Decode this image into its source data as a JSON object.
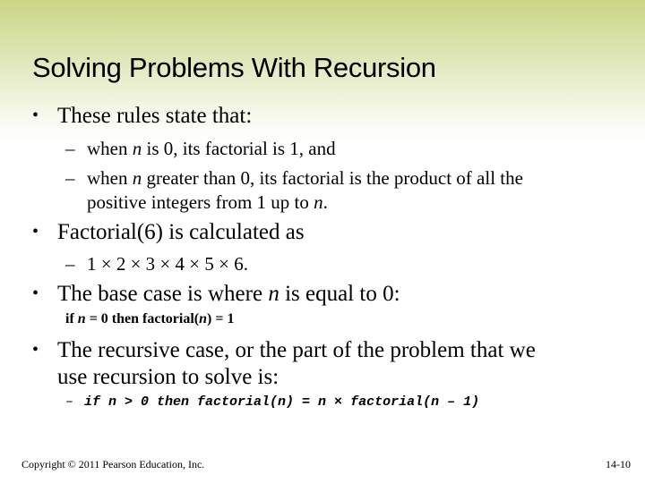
{
  "slide": {
    "title": "Solving Problems With Recursion",
    "bullets": [
      {
        "label": "These rules state that:"
      },
      {
        "label": "Factorial(6) is calculated as"
      },
      {
        "label": "The base case is where n is equal to 0:"
      },
      {
        "label_line1": "The recursive case, or the part of the problem that we",
        "label_line2": "use recursion to solve is:"
      }
    ],
    "sub_bullets": {
      "rule1": {
        "pre": "when ",
        "var": "n",
        "post": " is 0, its factorial is 1, and"
      },
      "rule2": {
        "pre": "when ",
        "var": "n",
        "post": " greater than 0, its factorial is the product of all the",
        "line2_pre": "positive integers from 1 up to ",
        "line2_var": "n",
        "line2_post": "."
      },
      "product": "1 × 2 × 3 × 4 × 5 × 6."
    },
    "base_case": {
      "pre": "if ",
      "var": "n",
      "mid": " = 0 then factorial(",
      "var2": "n",
      "post": ") = 1"
    },
    "recursive_case": {
      "dash": "–",
      "code": "if n > 0 then factorial(n) = n × factorial(n – 1)"
    },
    "bullet_symbol": "•",
    "dash_symbol": "–"
  },
  "footer": {
    "copyright": "Copyright © 2011 Pearson Education, Inc.",
    "page_number": "14-10"
  },
  "colors": {
    "header_gradient_top": "#cad685",
    "background": "#ffffff",
    "text": "#000000"
  }
}
